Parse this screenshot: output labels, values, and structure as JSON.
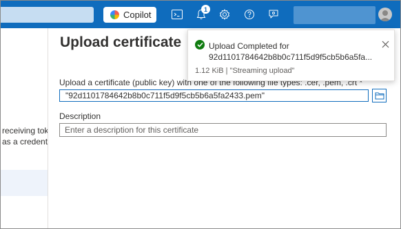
{
  "header": {
    "copilot_label": "Copilot",
    "notification_count": "1",
    "icons": [
      "cloud-shell-icon",
      "bell-icon",
      "gear-icon",
      "help-icon",
      "feedback-icon"
    ]
  },
  "left_panel": {
    "line1": "receiving tok",
    "line2": "as a credentia"
  },
  "blade": {
    "title": "Upload certificate",
    "file_label": "Upload a certificate (public key) with one of the following file types: .cer, .pem, .crt *",
    "file_value": "\"92d1101784642b8b0c711f5d9f5cb5b6a5fa2433.pem\"",
    "description_label": "Description",
    "description_placeholder": "Enter a description for this certificate"
  },
  "toast": {
    "title": "Upload Completed for 92d1101784642b8b0c711f5d9f5cb5b6a5fa...",
    "meta": "1.12 KiB | \"Streaming upload\"",
    "status_color": "#107c10"
  },
  "colors": {
    "topbar": "#0f6cbd",
    "accent": "#0f6cbd"
  }
}
